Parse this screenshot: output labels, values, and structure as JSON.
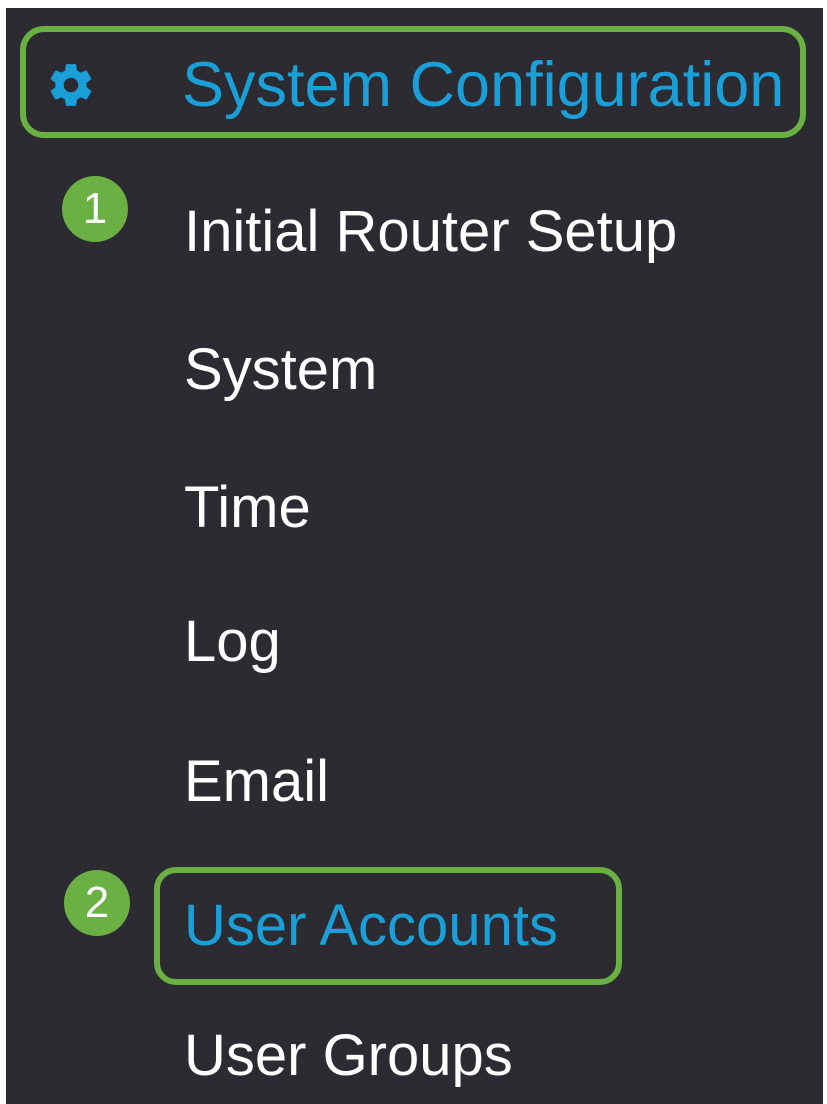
{
  "nav": {
    "section": {
      "label": "System Configuration",
      "icon": "gear-icon"
    },
    "items": [
      {
        "label": "Initial Router Setup"
      },
      {
        "label": "System"
      },
      {
        "label": "Time"
      },
      {
        "label": "Log"
      },
      {
        "label": "Email"
      },
      {
        "label": "User Accounts"
      },
      {
        "label": "User Groups"
      }
    ],
    "steps": [
      "1",
      "2"
    ]
  },
  "colors": {
    "background": "#2b2b31",
    "link_blue": "#1a9fd9",
    "highlight_green": "#6ab043",
    "text": "#ffffff"
  }
}
